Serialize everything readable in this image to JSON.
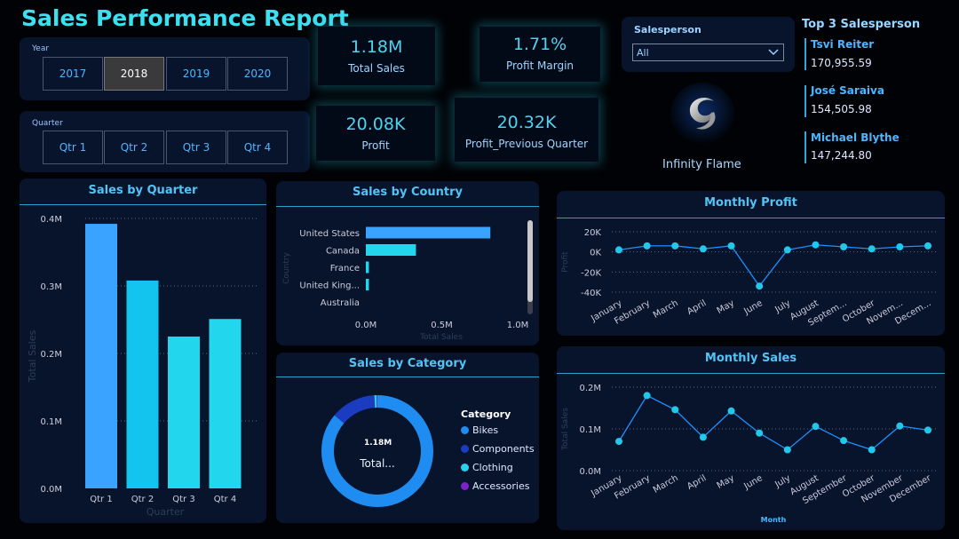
{
  "header": {
    "title": "Sales Performance Report"
  },
  "year_slicer": {
    "label": "Year",
    "options": [
      "2017",
      "2018",
      "2019",
      "2020"
    ],
    "selected": "2018"
  },
  "quarter_slicer": {
    "label": "Quarter",
    "options": [
      "Qtr 1",
      "Qtr 2",
      "Qtr 3",
      "Qtr 4"
    ]
  },
  "kpis": {
    "total_sales": {
      "value": "1.18M",
      "label": "Total Sales"
    },
    "profit_margin": {
      "value": "1.71%",
      "label": "Profit Margin"
    },
    "profit": {
      "value": "20.08K",
      "label": "Profit"
    },
    "profit_prev": {
      "value": "20.32K",
      "label": "Profit_Previous Quarter"
    }
  },
  "salesperson": {
    "label": "Salesperson",
    "value": "All"
  },
  "brand": {
    "name": "Infinity Flame"
  },
  "top3": {
    "title": "Top 3 Salesperson",
    "items": [
      {
        "name": "Tsvi Reiter",
        "value": "170,955.59"
      },
      {
        "name": "José Saraiva",
        "value": "154,505.98"
      },
      {
        "name": "Michael Blythe",
        "value": "147,244.80"
      }
    ]
  },
  "panels": {
    "sales_by_quarter": "Sales by Quarter",
    "sales_by_country": "Sales by Country",
    "sales_by_category": "Sales by Category",
    "monthly_profit": "Monthly Profit",
    "monthly_sales": "Monthly Sales"
  },
  "donut": {
    "center_value": "1.18M",
    "center_label": "Total...",
    "legend_title": "Category",
    "legend": [
      {
        "name": "Bikes",
        "color": "#1e8cf0"
      },
      {
        "name": "Components",
        "color": "#1b3cc0"
      },
      {
        "name": "Clothing",
        "color": "#2ad0ea"
      },
      {
        "name": "Accessories",
        "color": "#7b22c8"
      }
    ]
  },
  "chart_data": [
    {
      "type": "bar",
      "title": "Sales by Quarter",
      "categories": [
        "Qtr 1",
        "Qtr 2",
        "Qtr 3",
        "Qtr 4"
      ],
      "values": [
        0.392,
        0.308,
        0.225,
        0.251
      ],
      "xlabel": "Quarter",
      "ylabel": "Total Sales",
      "yticks": [
        "0.0M",
        "0.1M",
        "0.2M",
        "0.3M",
        "0.4M"
      ],
      "ylim": [
        0,
        0.4
      ],
      "colors": [
        "#3aa2ff",
        "#13c4ef",
        "#22d6ee",
        "#22d6ee"
      ]
    },
    {
      "type": "bar",
      "orientation": "horizontal",
      "title": "Sales by Country",
      "categories": [
        "United States",
        "Canada",
        "France",
        "United King...",
        "Australia"
      ],
      "values": [
        0.82,
        0.33,
        0.02,
        0.02,
        0.0
      ],
      "xlabel": "Total Sales",
      "ylabel": "Country",
      "xticks": [
        "0.0M",
        "0.5M",
        "1.0M"
      ],
      "xlim": [
        0,
        1.0
      ],
      "colors": [
        "#3aa2ff",
        "#22d6ee",
        "#22d6ee",
        "#22d6ee",
        "#22d6ee"
      ]
    },
    {
      "type": "pie",
      "title": "Sales by Category",
      "categories": [
        "Bikes",
        "Components",
        "Clothing",
        "Accessories"
      ],
      "values": [
        0.86,
        0.13,
        0.007,
        0.003
      ]
    },
    {
      "type": "line",
      "title": "Monthly Profit",
      "categories": [
        "January",
        "February",
        "March",
        "April",
        "May",
        "June",
        "July",
        "August",
        "Septem...",
        "October",
        "Novem...",
        "Decem..."
      ],
      "values": [
        2,
        6,
        6,
        3,
        6,
        -34,
        2,
        7,
        5,
        3,
        5,
        6
      ],
      "ylabel": "Profit",
      "yticks": [
        "20K",
        "0K",
        "-20K",
        "-40K"
      ],
      "ylim": [
        -40,
        20
      ]
    },
    {
      "type": "line",
      "title": "Monthly Sales",
      "categories": [
        "January",
        "February",
        "March",
        "April",
        "May",
        "June",
        "July",
        "August",
        "September",
        "October",
        "November",
        "December"
      ],
      "values": [
        0.07,
        0.18,
        0.146,
        0.08,
        0.143,
        0.09,
        0.05,
        0.106,
        0.072,
        0.05,
        0.107,
        0.097
      ],
      "xlabel": "Month",
      "ylabel": "Total Sales",
      "yticks": [
        "0.0M",
        "0.1M",
        "0.2M"
      ],
      "ylim": [
        0,
        0.2
      ]
    }
  ]
}
